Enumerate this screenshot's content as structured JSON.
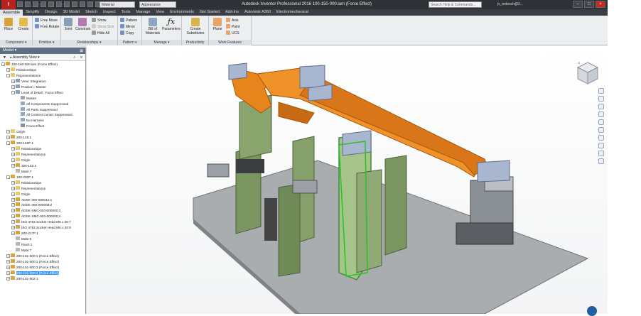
{
  "app": {
    "logo": "I",
    "title": "Autodesk Inventor Professional 2016   100-150-000.iam (Force Effect)",
    "material_select": "Material",
    "appearance_select": "Appearance",
    "search_placeholder": "Search Help & Commands...",
    "user": "jv_tedesch@2...",
    "window_buttons": [
      "–",
      "□",
      "×"
    ]
  },
  "tabs": [
    "Assemble",
    "Simplify",
    "Design",
    "3D Model",
    "Sketch",
    "Inspect",
    "Tools",
    "Manage",
    "View",
    "Environments",
    "Get Started",
    "Add-Ins",
    "Autodesk A360",
    "Electromechanical"
  ],
  "active_tab": "Assemble",
  "ribbon": {
    "groups": [
      {
        "label": "Component ▾"
      },
      {
        "label": "Position ▾"
      },
      {
        "label": "Relationships ▾"
      },
      {
        "label": "Pattern ▾"
      },
      {
        "label": "Manage ▾"
      },
      {
        "label": "Productivity"
      },
      {
        "label": "Work Features"
      }
    ],
    "place": "Place",
    "create": "Create",
    "free_move": "Free Move",
    "free_rotate": "Free Rotate",
    "joint": "Joint",
    "constrain": "Constrain",
    "show": "Show",
    "show_sick": "Show Sick",
    "hide_all": "Hide All",
    "pattern": "Pattern",
    "mirror": "Mirror",
    "copy": "Copy",
    "bill_of_materials": "Bill of Materials",
    "parameters": "Parameters",
    "create_substitutes": "Create Substitutes",
    "plane": "Plane",
    "axis": "Axis",
    "point": "Point",
    "ucs": "UCS"
  },
  "browser": {
    "header": "Model",
    "view_label": "Assembly View",
    "nodes": [
      {
        "label": "100-150-000.iam (Force Effect)",
        "indent": 0,
        "expand": "-",
        "icon": "assembly"
      },
      {
        "label": "Relationships",
        "indent": 1,
        "expand": "+",
        "icon": "folder"
      },
      {
        "label": "Representations",
        "indent": 1,
        "expand": "-",
        "icon": "folder"
      },
      {
        "label": "View: Integration",
        "indent": 2,
        "expand": "+",
        "icon": "view"
      },
      {
        "label": "Position : Master",
        "indent": 2,
        "expand": "+",
        "icon": "view"
      },
      {
        "label": "Level of Detail : Force Effect",
        "indent": 2,
        "expand": "-",
        "icon": "view"
      },
      {
        "label": "Master",
        "indent": 3,
        "expand": "",
        "icon": "lod"
      },
      {
        "label": "All Components Suppressed",
        "indent": 3,
        "expand": "",
        "icon": "lod"
      },
      {
        "label": "All Parts Suppressed",
        "indent": 3,
        "expand": "",
        "icon": "lod"
      },
      {
        "label": "All Content Center Suppressed",
        "indent": 3,
        "expand": "",
        "icon": "lod"
      },
      {
        "label": "No Harness",
        "indent": 3,
        "expand": "",
        "icon": "lod"
      },
      {
        "label": "Force Effect",
        "indent": 3,
        "expand": "",
        "icon": "lodcheck"
      },
      {
        "label": "Origin",
        "indent": 1,
        "expand": "+",
        "icon": "folder"
      },
      {
        "label": "200-125:1",
        "indent": 1,
        "expand": "+",
        "icon": "assembly"
      },
      {
        "label": "300-150F:1",
        "indent": 1,
        "expand": "-",
        "icon": "assembly"
      },
      {
        "label": "Relationships",
        "indent": 2,
        "expand": "+",
        "icon": "folder"
      },
      {
        "label": "Representations",
        "indent": 2,
        "expand": "+",
        "icon": "folder"
      },
      {
        "label": "Origin",
        "indent": 2,
        "expand": "+",
        "icon": "folder"
      },
      {
        "label": "300-152:2",
        "indent": 2,
        "expand": "+",
        "icon": "assembly"
      },
      {
        "label": "Mate:7",
        "indent": 2,
        "expand": "",
        "icon": "mate"
      },
      {
        "label": "100-200F:1",
        "indent": 1,
        "expand": "-",
        "icon": "assembly"
      },
      {
        "label": "Relationships",
        "indent": 2,
        "expand": "+",
        "icon": "folder"
      },
      {
        "label": "Representations",
        "indent": 2,
        "expand": "+",
        "icon": "folder"
      },
      {
        "label": "Origin",
        "indent": 2,
        "expand": "+",
        "icon": "folder"
      },
      {
        "label": "ADSK-300-000012:1",
        "indent": 2,
        "expand": "+",
        "icon": "assembly"
      },
      {
        "label": "ADSK-300-000008:2",
        "indent": 2,
        "expand": "+",
        "icon": "assembly"
      },
      {
        "label": "ADSK-SMC-003-000000:3",
        "indent": 2,
        "expand": "+",
        "icon": "assembly"
      },
      {
        "label": "ADSK-SMC-003-000000:4",
        "indent": 2,
        "expand": "+",
        "icon": "assembly"
      },
      {
        "label": "ISO 4762  Socket Head M6 x 20:7",
        "indent": 2,
        "expand": "+",
        "icon": "part"
      },
      {
        "label": "ISO 4762  Socket Head M6 x 20:8",
        "indent": 2,
        "expand": "+",
        "icon": "part"
      },
      {
        "label": "200-217F:1",
        "indent": 2,
        "expand": "+",
        "icon": "assembly"
      },
      {
        "label": "Mate:6",
        "indent": 2,
        "expand": "",
        "icon": "mate"
      },
      {
        "label": "Flush:1",
        "indent": 2,
        "expand": "",
        "icon": "mate"
      },
      {
        "label": "Mate:7",
        "indent": 2,
        "expand": "",
        "icon": "mate"
      },
      {
        "label": "200-101-000:1 (Force Effect)",
        "indent": 1,
        "expand": "+",
        "icon": "assembly"
      },
      {
        "label": "200-101-000:2 (Force Effect)",
        "indent": 1,
        "expand": "+",
        "icon": "assembly"
      },
      {
        "label": "200-101-000:3 (Force Effect)",
        "indent": 1,
        "expand": "+",
        "icon": "assembly"
      },
      {
        "label": "200-101-000:4 (Force Effect)",
        "indent": 1,
        "expand": "+",
        "icon": "assembly",
        "selected": true
      },
      {
        "label": "200-101-002:1",
        "indent": 1,
        "expand": "+",
        "icon": "assembly"
      }
    ]
  },
  "viewport": {
    "viewcube_icon": "viewcube-icon",
    "nav_icons": [
      "full-nav-wheel-icon",
      "pan-icon",
      "zoom-icon",
      "zoom-window-icon",
      "orbit-icon",
      "look-at-icon",
      "orbit-constrained-icon",
      "rewind-icon"
    ]
  },
  "colors": {
    "title_bar": "#2e3136",
    "logo_red": "#b8211e",
    "orange_part": "#e8841c",
    "green_part": "#7a9560",
    "plate": "#a9adaf",
    "selection_blue": "#3399ff"
  }
}
